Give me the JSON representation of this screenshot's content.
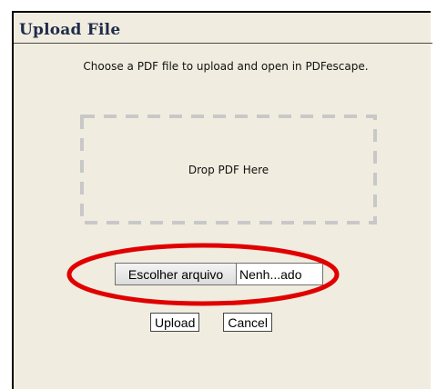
{
  "dialog": {
    "title": "Upload File",
    "subtitle": "Choose a PDF file to upload and open in PDFescape."
  },
  "dropzone": {
    "label": "Drop PDF Here"
  },
  "file_input": {
    "button_label": "Escolher arquivo",
    "status_text": "Nenh...ado"
  },
  "actions": {
    "upload_label": "Upload",
    "cancel_label": "Cancel"
  },
  "colors": {
    "panel_background": "#f0ecdf",
    "title_text": "#1f2b4a",
    "highlight_ring": "#e00000",
    "dropzone_dash": "#c8c8c8"
  }
}
